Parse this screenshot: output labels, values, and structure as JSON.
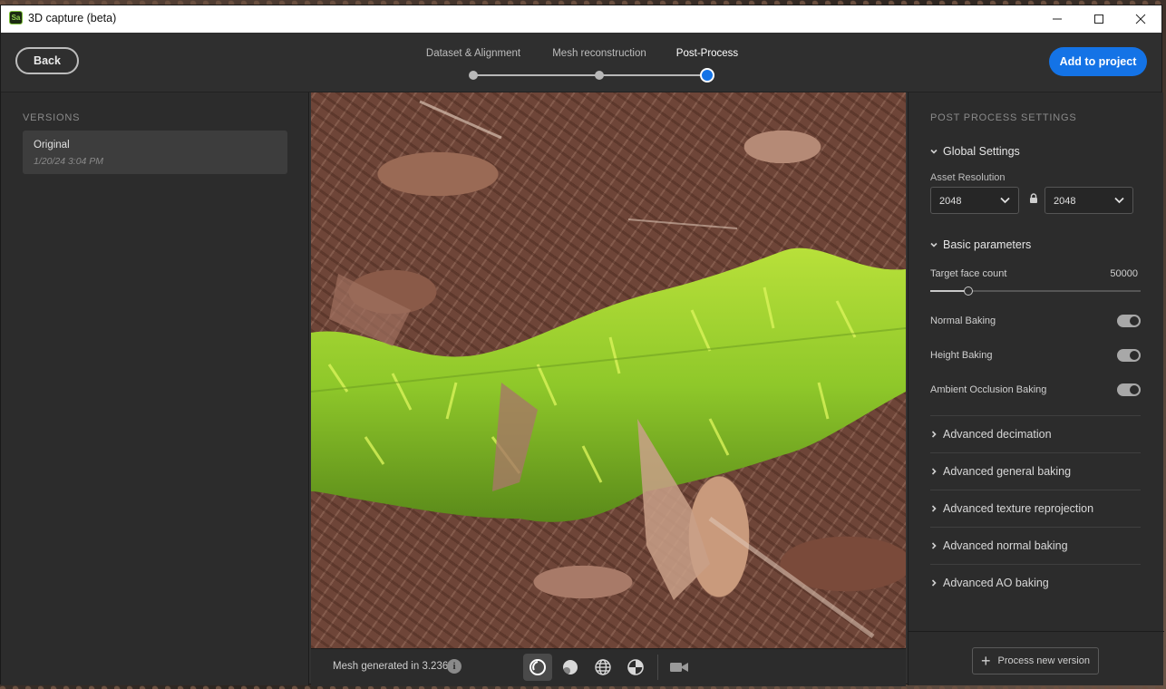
{
  "window": {
    "title": "3D capture (beta)",
    "app_badge": "Sa",
    "controls": {
      "minimize": "minimize-icon",
      "maximize": "maximize-icon",
      "close": "close-icon"
    }
  },
  "header": {
    "back_label": "Back",
    "add_label": "Add to project",
    "steps": [
      {
        "label": "Dataset & Alignment",
        "active": false
      },
      {
        "label": "Mesh reconstruction",
        "active": false
      },
      {
        "label": "Post-Process",
        "active": true
      }
    ]
  },
  "versions": {
    "title": "VERSIONS",
    "items": [
      {
        "name": "Original",
        "date": "1/20/24 3:04 PM"
      }
    ]
  },
  "viewport": {
    "status": "Mesh generated in 3.236s",
    "tools": [
      "render-mode-icon",
      "material-sphere-icon",
      "wireframe-globe-icon",
      "uv-checker-icon",
      "camera-icon"
    ]
  },
  "settings": {
    "title": "POST PROCESS SETTINGS",
    "global": {
      "heading": "Global Settings",
      "asset_resolution_label": "Asset Resolution",
      "res_width": "2048",
      "res_height": "2048"
    },
    "basic": {
      "heading": "Basic parameters",
      "face_count_label": "Target face count",
      "face_count_value": "50000",
      "face_count_fraction": 0.18,
      "normal_baking": "Normal Baking",
      "height_baking": "Height Baking",
      "ao_baking": "Ambient Occlusion Baking"
    },
    "advanced": [
      "Advanced decimation",
      "Advanced general baking",
      "Advanced texture reprojection",
      "Advanced normal baking",
      "Advanced AO baking"
    ],
    "process_label": "Process new version"
  },
  "colors": {
    "accent": "#1473e6",
    "panel": "#2c2c2c",
    "moss": "#8fc82a"
  }
}
